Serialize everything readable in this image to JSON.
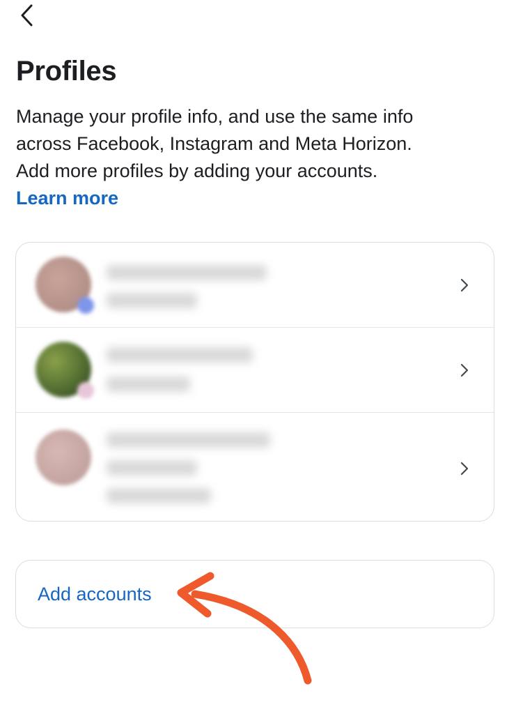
{
  "header": {
    "back_icon": "chevron-left-icon"
  },
  "page": {
    "title": "Profiles",
    "description_lines": [
      "Manage your profile info, and use the same info",
      "across Facebook, Instagram and Meta Horizon.",
      "Add more profiles by adding your accounts."
    ],
    "learn_more": "Learn more"
  },
  "profiles": {
    "note": "",
    "items": [
      {
        "row_icon": "chevron-right-icon"
      },
      {
        "row_icon": "chevron-right-icon"
      },
      {
        "row_icon": "chevron-right-icon"
      }
    ]
  },
  "add_accounts": {
    "label": "Add accounts"
  },
  "annotation": {
    "arrow_icon": "curved-arrow-icon",
    "arrow_color": "#ee5a2b"
  },
  "colors": {
    "link": "#1667c2",
    "text": "#1c1e21",
    "border": "#dadde1"
  }
}
